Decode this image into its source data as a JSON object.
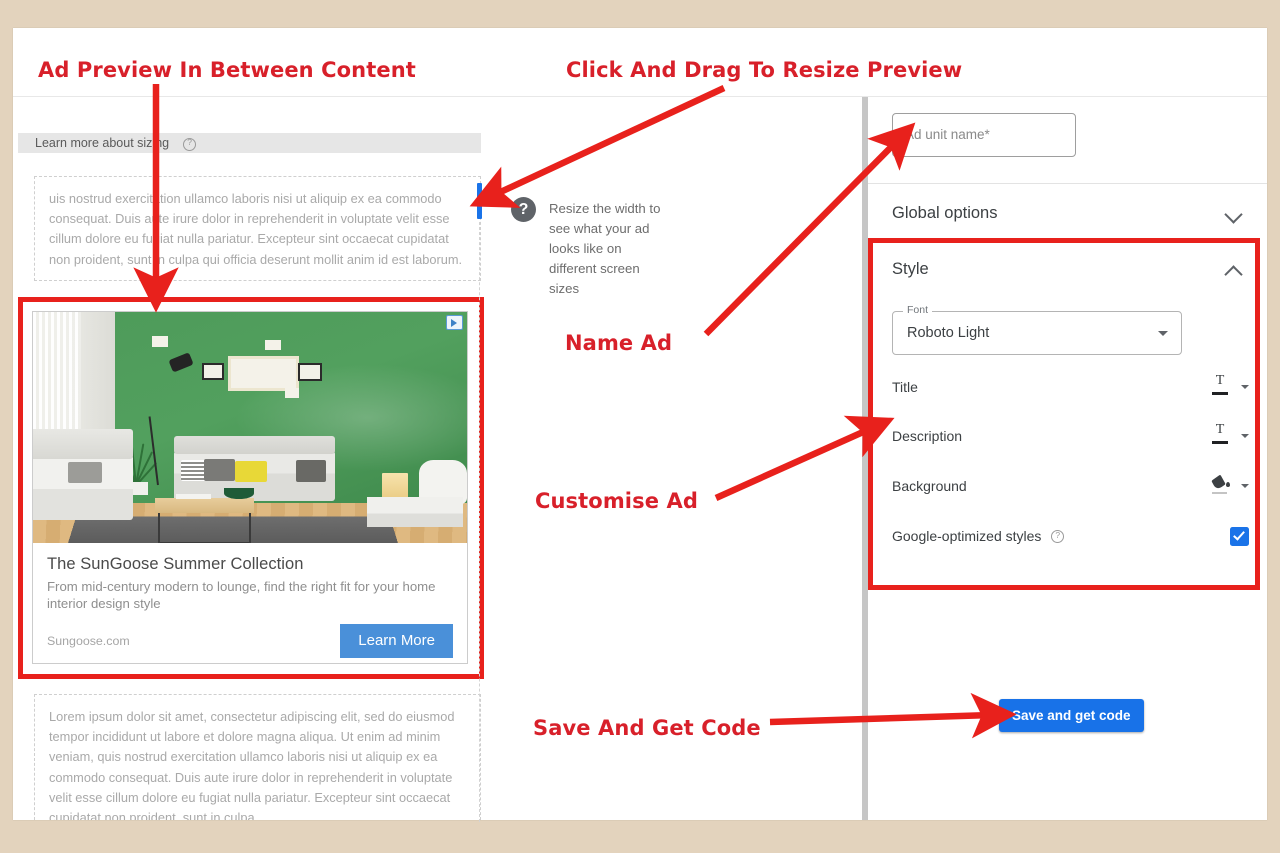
{
  "theme": {
    "page_background": "#e3d3bd",
    "annotation_red": "#d8202a",
    "box_red": "#e8211c",
    "google_blue": "#1a73e8",
    "cta_blue": "#4a90d9",
    "wall_green": "#4e9b5a"
  },
  "annotations": {
    "preview": "Ad Preview In Between Content",
    "resize": "Click And Drag To Resize Preview",
    "name": "Name Ad",
    "customise": "Customise Ad",
    "save": "Save And Get Code"
  },
  "left_panel": {
    "sizing_bar": {
      "label": "Learn more about sizing",
      "help_icon": "help-circle-icon"
    },
    "article_top": "uis nostrud exercitation ullamco laboris nisi ut aliquip ex ea commodo consequat. Duis aute irure dolor in reprehenderit in voluptate velit esse cillum dolore eu fugiat nulla pariatur. Excepteur sint occaecat cupidatat non proident, sunt in culpa qui officia deserunt mollit anim id est laborum.",
    "article_bottom": "Lorem ipsum dolor sit amet, consectetur adipiscing elit, sed do eiusmod tempor incididunt ut labore et dolore magna aliqua. Ut enim ad minim veniam, quis nostrud exercitation ullamco laboris nisi ut aliquip ex ea commodo consequat. Duis aute irure dolor in reprehenderit in voluptate velit esse cillum dolore eu fugiat nulla pariatur. Excepteur sint occaecat cupidatat non proident, sunt in culpa"
  },
  "ad_unit": {
    "adchoices_icon": "adchoices-icon",
    "image_alt": "green-wall-living-room-photo",
    "title": "The SunGoose Summer Collection",
    "description": "From mid-century modern to lounge, find the right fit for your home interior design style",
    "domain": "Sungoose.com",
    "cta_label": "Learn More"
  },
  "resizer": {
    "handle_icon": "resize-handle",
    "badge_icon": "question-mark-icon",
    "hint": "Resize the width to see what your ad looks like on different screen sizes"
  },
  "right_panel": {
    "ad_name": {
      "placeholder": "Ad unit name*",
      "value": ""
    },
    "sections": [
      {
        "title": "Global options",
        "state": "collapsed",
        "chevron": "chevron-down-icon"
      },
      {
        "title": "Style",
        "state": "expanded",
        "chevron": "chevron-up-icon"
      }
    ],
    "font": {
      "legend": "Font",
      "value": "Roboto Light",
      "caret": "caret-down-icon"
    },
    "style_rows": [
      {
        "label": "Title",
        "icon": "text-color-icon",
        "caret": "caret-down-icon"
      },
      {
        "label": "Description",
        "icon": "text-color-icon",
        "caret": "caret-down-icon"
      },
      {
        "label": "Background",
        "icon": "fill-color-icon",
        "caret": "caret-down-icon"
      }
    ],
    "google_optimized": {
      "label": "Google-optimized styles",
      "help_icon": "help-circle-icon",
      "checked": true
    },
    "save_button": "Save and get code"
  }
}
